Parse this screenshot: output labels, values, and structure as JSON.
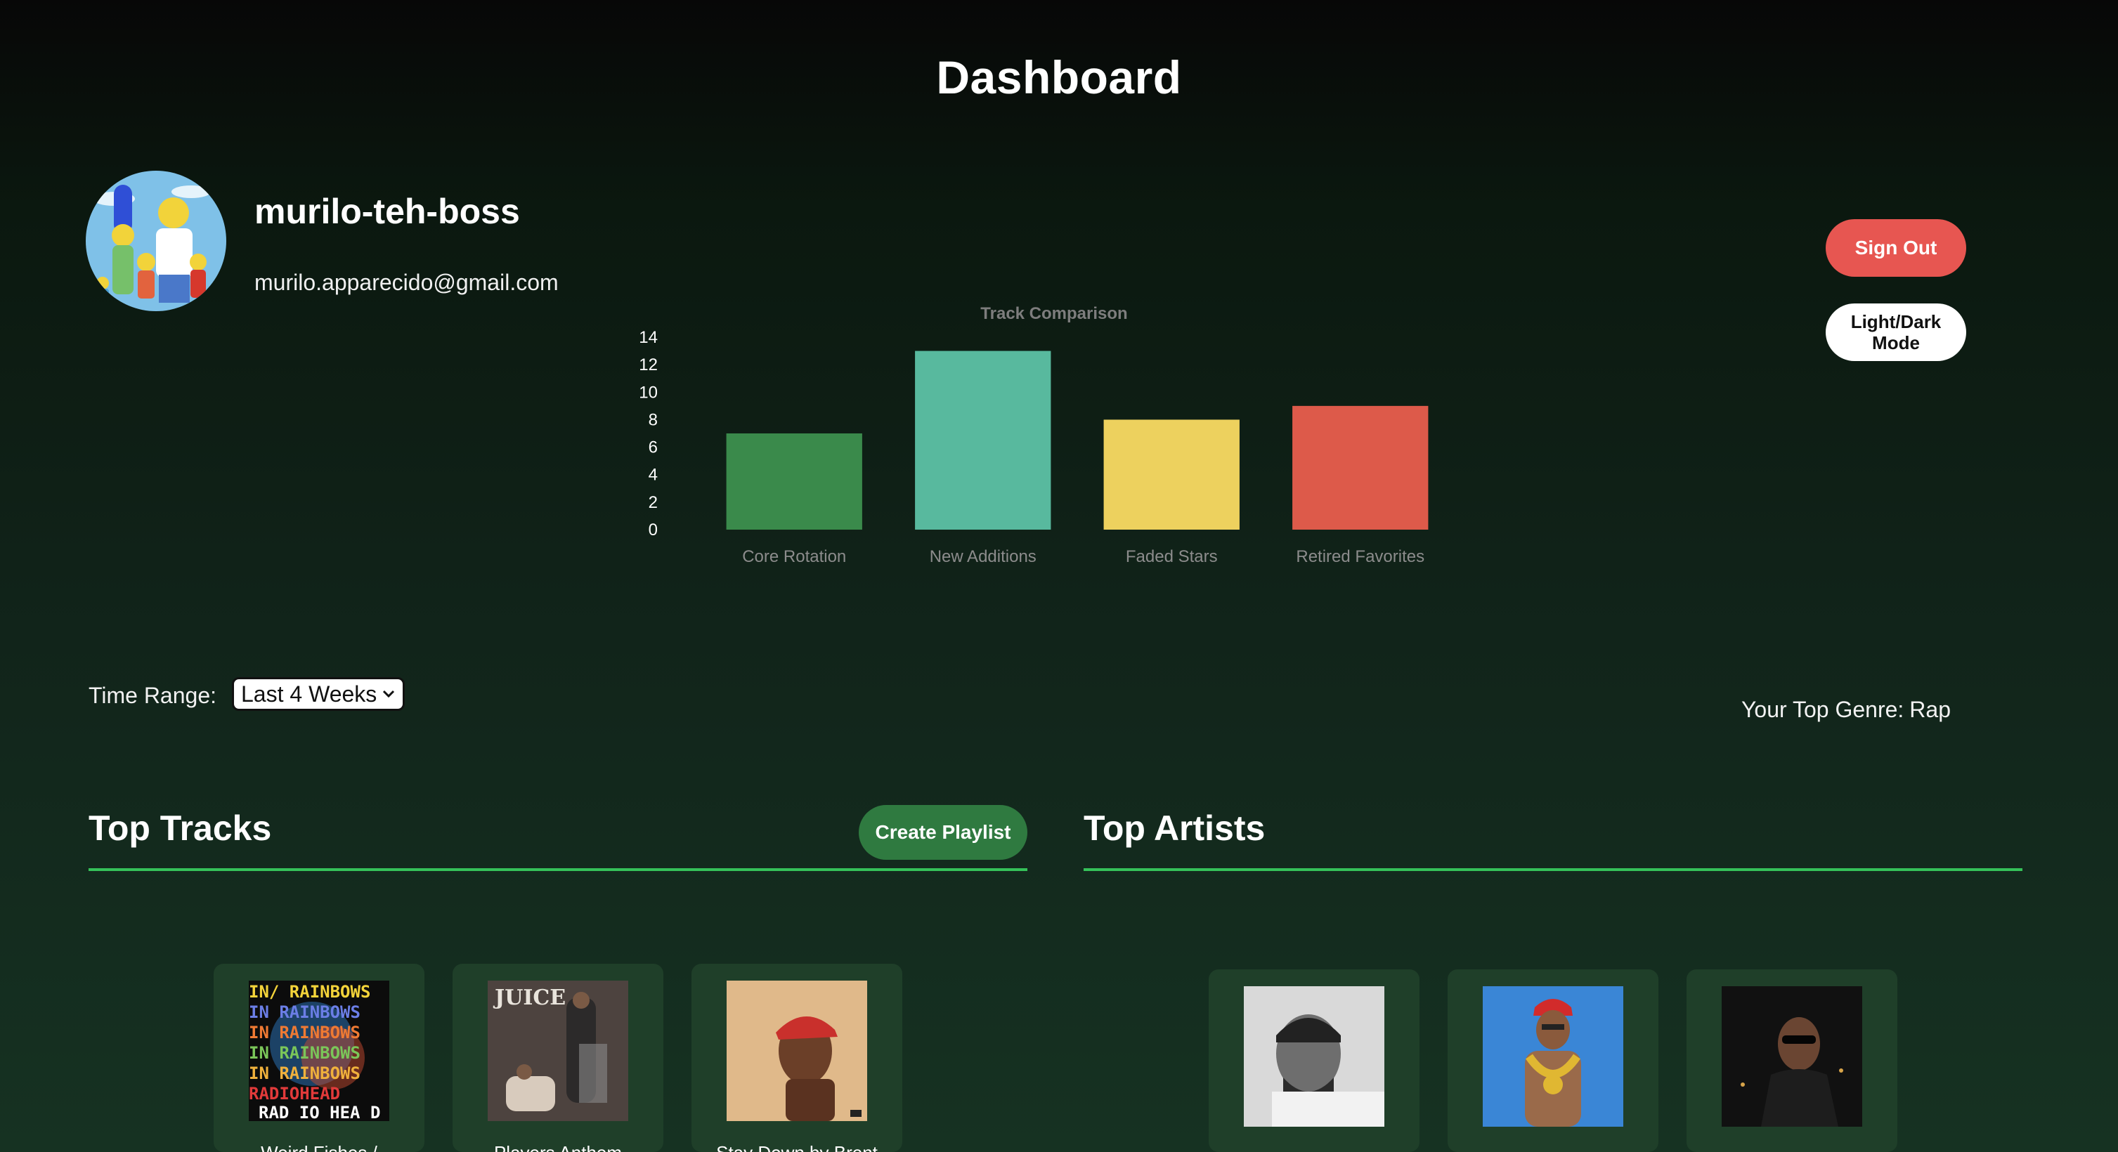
{
  "page": {
    "title": "Dashboard"
  },
  "profile": {
    "username": "murilo-teh-boss",
    "email": "murilo.apparecido@gmail.com",
    "avatar_icon": "family-cartoon-avatar"
  },
  "actions": {
    "sign_out_label": "Sign Out",
    "mode_toggle_label": "Light/Dark Mode"
  },
  "chart_data": {
    "type": "bar",
    "title": "Track Comparison",
    "categories": [
      "Core Rotation",
      "New Additions",
      "Faded Stars",
      "Retired Favorites"
    ],
    "values": [
      7,
      13,
      8,
      9
    ],
    "colors": [
      "#3a8a4b",
      "#58b99e",
      "#edd15e",
      "#dd5a4a"
    ],
    "yticks": [
      0,
      2,
      4,
      6,
      8,
      10,
      12,
      14
    ],
    "ylim": [
      0,
      14
    ],
    "xlabel": "",
    "ylabel": "",
    "grid": false,
    "legend": "none"
  },
  "filters": {
    "time_range_label": "Time Range:",
    "time_range_value": "Last 4 Weeks",
    "time_range_icon": "chevron-down-icon"
  },
  "genre": {
    "label": "Your Top Genre:",
    "value": "Rap"
  },
  "top_tracks": {
    "title": "Top Tracks",
    "create_playlist_label": "Create Playlist",
    "items": [
      {
        "title": "Weird Fishes /",
        "art": "in-rainbows-cover"
      },
      {
        "title": "Players Anthem",
        "art": "juice-cover"
      },
      {
        "title": "Stay Down by Brent",
        "art": "red-cap-portrait-cover"
      }
    ]
  },
  "top_artists": {
    "title": "Top Artists",
    "items": [
      {
        "name": "",
        "art": "artist-portrait-bw"
      },
      {
        "name": "",
        "art": "artist-portrait-blue"
      },
      {
        "name": "",
        "art": "artist-portrait-night"
      }
    ]
  },
  "colors": {
    "accent_green": "#35c25a",
    "sign_out": "#e75651",
    "create_playlist": "#2f7a40",
    "card_bg": "#1f3f29"
  }
}
